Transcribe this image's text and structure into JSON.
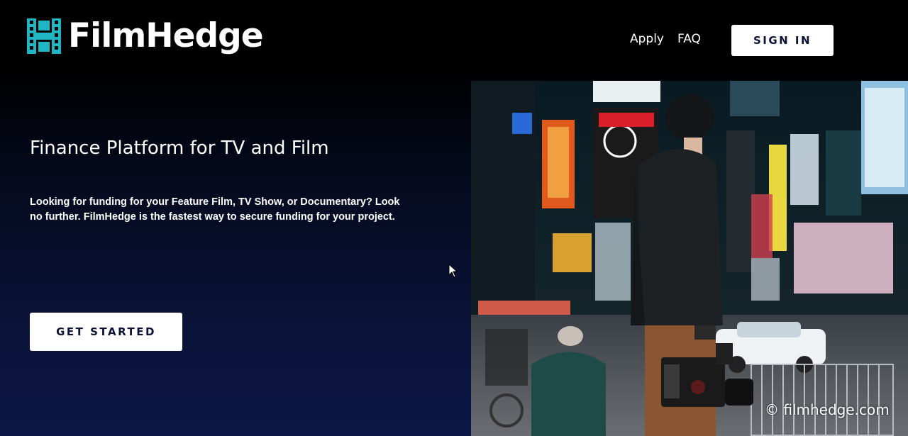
{
  "brand": {
    "name": "FilmHedge",
    "accent_color": "#1fb5c2",
    "logo_icon": "film-strip-h-icon"
  },
  "nav": {
    "apply_label": "Apply",
    "faq_label": "FAQ",
    "signin_label": "SIGN IN"
  },
  "hero": {
    "title": "Finance Platform for TV and Film",
    "description": "Looking for funding for your Feature Film, TV Show, or Documentary? Look no further. FilmHedge is the fastest way to secure funding for your project.",
    "cta_label": "GET STARTED",
    "image_subject": "filmmaker-with-camera-in-times-square"
  },
  "watermark": "© filmhedge.com",
  "colors": {
    "background_top": "#000000",
    "background_bottom": "#0d1747",
    "button_bg": "#ffffff",
    "button_text": "#0b1437"
  }
}
